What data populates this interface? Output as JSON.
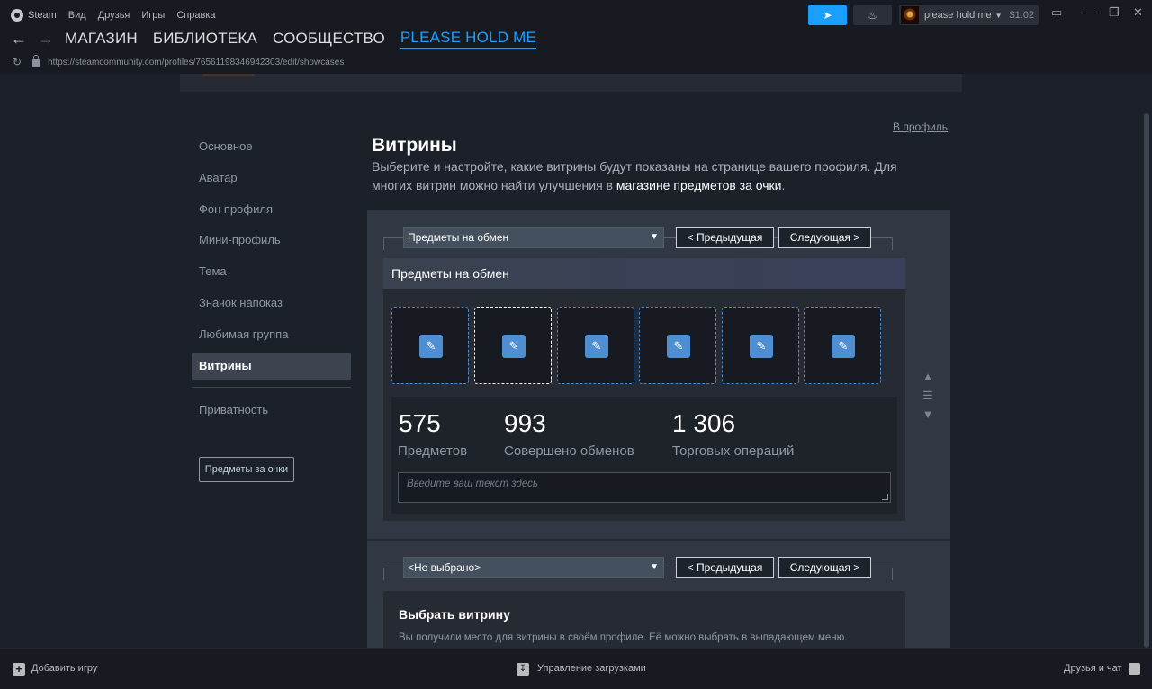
{
  "menu": {
    "items": [
      "Steam",
      "Вид",
      "Друзья",
      "Игры",
      "Справка"
    ]
  },
  "nav": {
    "back_icon": "arrow-left-icon",
    "forward_icon": "arrow-right-icon",
    "tabs": [
      "МАГАЗИН",
      "БИБЛИОТЕКА",
      "СООБЩЕСТВО",
      "PLEASE HOLD ME"
    ]
  },
  "url": "https://steamcommunity.com/profiles/76561198346942303/edit/showcases",
  "user": {
    "name": "please hold me",
    "balance": "$1.02"
  },
  "profile_link": "В профиль",
  "sidebar": {
    "items": [
      "Основное",
      "Аватар",
      "Фон профиля",
      "Мини-профиль",
      "Тема",
      "Значок напоказ",
      "Любимая группа",
      "Витрины"
    ],
    "privacy": "Приватность",
    "points_button": "Предметы за очки"
  },
  "page": {
    "title": "Витрины",
    "desc_part1": "Выберите и настройте, какие витрины будут показаны на странице вашего профиля. Для многих витрин можно найти улучшения в ",
    "desc_link": "магазине предметов за очки",
    "desc_part2": "."
  },
  "showcase1": {
    "select_value": "Предметы на обмен",
    "prev_label": "< Предыдущая",
    "next_label": "Следующая >",
    "header": "Предметы на обмен",
    "stats": [
      {
        "value": "575",
        "label": "Предметов"
      },
      {
        "value": "993",
        "label": "Совершено обменов"
      },
      {
        "value": "1 306",
        "label": "Торговых операций"
      }
    ],
    "text_placeholder": "Введите ваш текст здесь"
  },
  "showcase2": {
    "select_value": "<Не выбрано>",
    "prev_label": "< Предыдущая",
    "next_label": "Следующая >",
    "title": "Выбрать витрину",
    "desc": "Вы получили место для витрины в своём профиле. Её можно выбрать в выпадающем меню."
  },
  "bottom": {
    "add_game": "Добавить игру",
    "downloads": "Управление загрузками",
    "friends": "Друзья и чат"
  },
  "colors": {
    "accent": "#1a9fff",
    "slot_border": "#4f8ed0"
  }
}
